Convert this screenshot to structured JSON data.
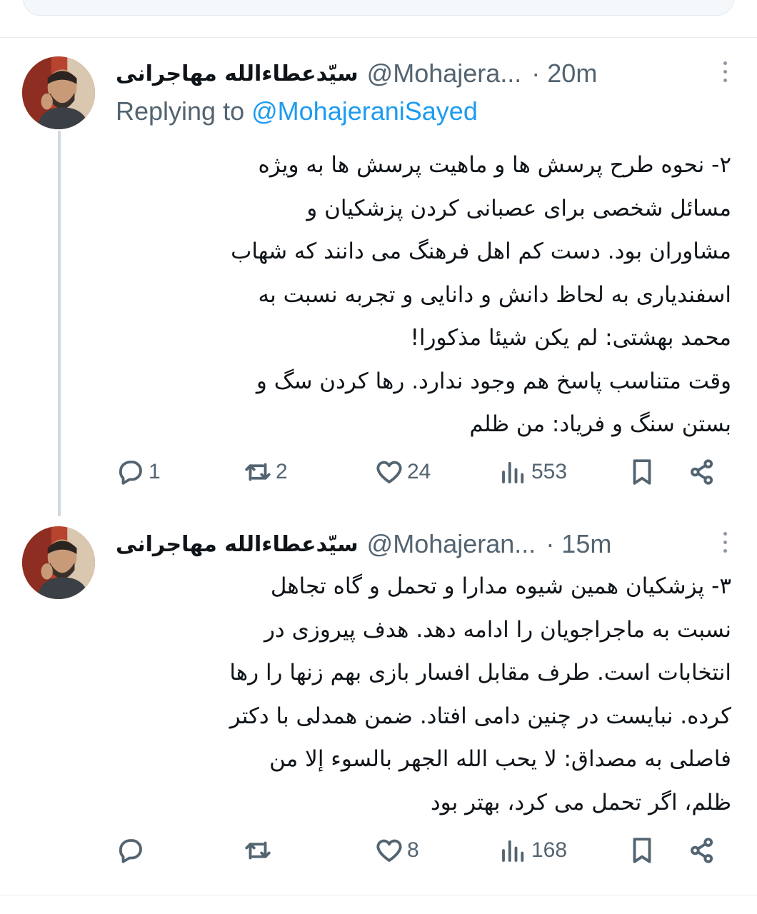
{
  "tweets": [
    {
      "author_name": "سیّدعطاءالله مهاجرانی",
      "handle": "@Mohajera...",
      "time": "· 20m",
      "replying_prefix": "Replying to",
      "replying_to": "@MohajeraniSayed",
      "lines": [
        "۲- نحوه طرح پرسش ها و ماهیت پرسش ها به ویژه",
        "مسائل شخصی برای عصبانی کردن پزشکیان و",
        "مشاوران بود. دست کم اهل فرهنگ می دانند که شهاب",
        "اسفندیاری به لحاظ دانش و دانایی و تجربه نسبت به",
        "محمد بهشتی: لم یکن شیئا مذکورا!",
        "وقت متناسب پاسخ هم وجود ندارد. رها کردن سگ و",
        "بستن سنگ و  فریاد: من ظلم"
      ],
      "replies": "1",
      "retweets": "2",
      "likes": "24",
      "views": "553"
    },
    {
      "author_name": "سیّدعطاءالله مهاجرانی",
      "handle": "@Mohajeran...",
      "time": "· 15m",
      "lines": [
        "۳- پزشکیان همین شیوه مدارا و تحمل و گاه تجاهل",
        "نسبت به ماجراجویان را ادامه دهد. هدف پیروزی در",
        "انتخابات است. طرف مقابل افسار بازی بهم زنها را رها",
        "کرده. نبایست در چنین دامی افتاد. ضمن همدلی با دکتر",
        "فاصلی به مصداق: لا یحب الله الجهر بالسوء إلا من",
        "ظلم، اگر تحمل می کرد، بهتر بود"
      ],
      "replies": "",
      "retweets": "",
      "likes": "8",
      "views": "168"
    }
  ],
  "icons": {
    "reply": "reply-icon",
    "retweet": "retweet-icon",
    "like": "heart-icon",
    "views": "views-icon",
    "bookmark": "bookmark-icon",
    "share": "share-icon",
    "more": "more-icon"
  },
  "colors": {
    "link": "#1d9bf0",
    "secondary_text": "#536471",
    "primary_text": "#0f1419",
    "thread_line": "#cfd9de"
  }
}
